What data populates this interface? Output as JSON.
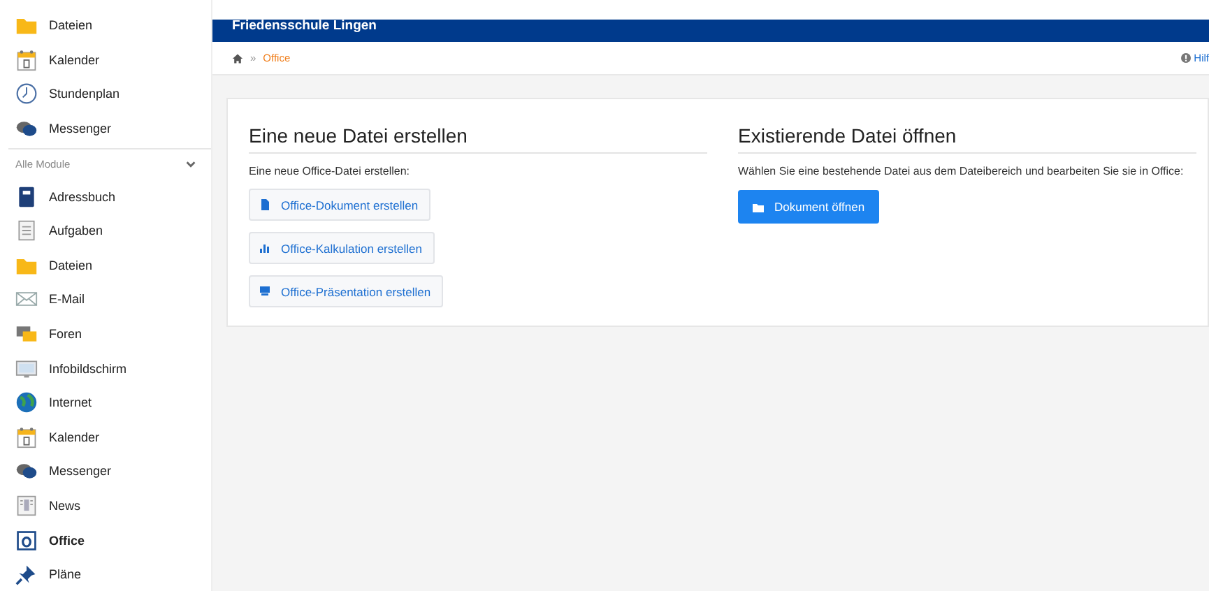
{
  "sidebar": {
    "favorites": [
      {
        "kind": "folder",
        "label": "Dateien",
        "selected": false
      },
      {
        "kind": "calendar",
        "label": "Kalender",
        "selected": false
      },
      {
        "kind": "clock",
        "label": "Stundenplan",
        "selected": false
      },
      {
        "kind": "chat",
        "label": "Messenger",
        "selected": false
      }
    ],
    "section": {
      "label": "Alle Module",
      "expanded": true
    },
    "modules": [
      {
        "kind": "addressbook",
        "label": "Adressbuch",
        "selected": false
      },
      {
        "kind": "tasks",
        "label": "Aufgaben",
        "selected": false
      },
      {
        "kind": "folder",
        "label": "Dateien",
        "selected": false
      },
      {
        "kind": "mail",
        "label": "E-Mail",
        "selected": false
      },
      {
        "kind": "forum",
        "label": "Foren",
        "selected": false
      },
      {
        "kind": "screen",
        "label": "Infobildschirm",
        "selected": false
      },
      {
        "kind": "globe",
        "label": "Internet",
        "selected": false
      },
      {
        "kind": "calendar",
        "label": "Kalender",
        "selected": false
      },
      {
        "kind": "chat",
        "label": "Messenger",
        "selected": false
      },
      {
        "kind": "news",
        "label": "News",
        "selected": false
      },
      {
        "kind": "office",
        "label": "Office",
        "selected": true
      },
      {
        "kind": "pin",
        "label": "Pläne",
        "selected": false
      }
    ]
  },
  "header": {
    "title": "Friedensschule Lingen"
  },
  "breadcrumb": {
    "separator": "»",
    "current": "Office",
    "help": "Hilf"
  },
  "create": {
    "heading": "Eine neue Datei erstellen",
    "text": "Eine neue Office-Datei erstellen:",
    "buttons": [
      {
        "kind": "document",
        "label": "Office-Dokument erstellen"
      },
      {
        "kind": "spreadsheet",
        "label": "Office-Kalkulation erstellen"
      },
      {
        "kind": "presentation",
        "label": "Office-Präsentation erstellen"
      }
    ]
  },
  "open": {
    "heading": "Existierende Datei öffnen",
    "text": "Wählen Sie eine bestehende Datei aus dem Dateibereich und bearbeiten Sie sie in Office:",
    "button": {
      "kind": "folder",
      "label": "Dokument öffnen"
    }
  }
}
